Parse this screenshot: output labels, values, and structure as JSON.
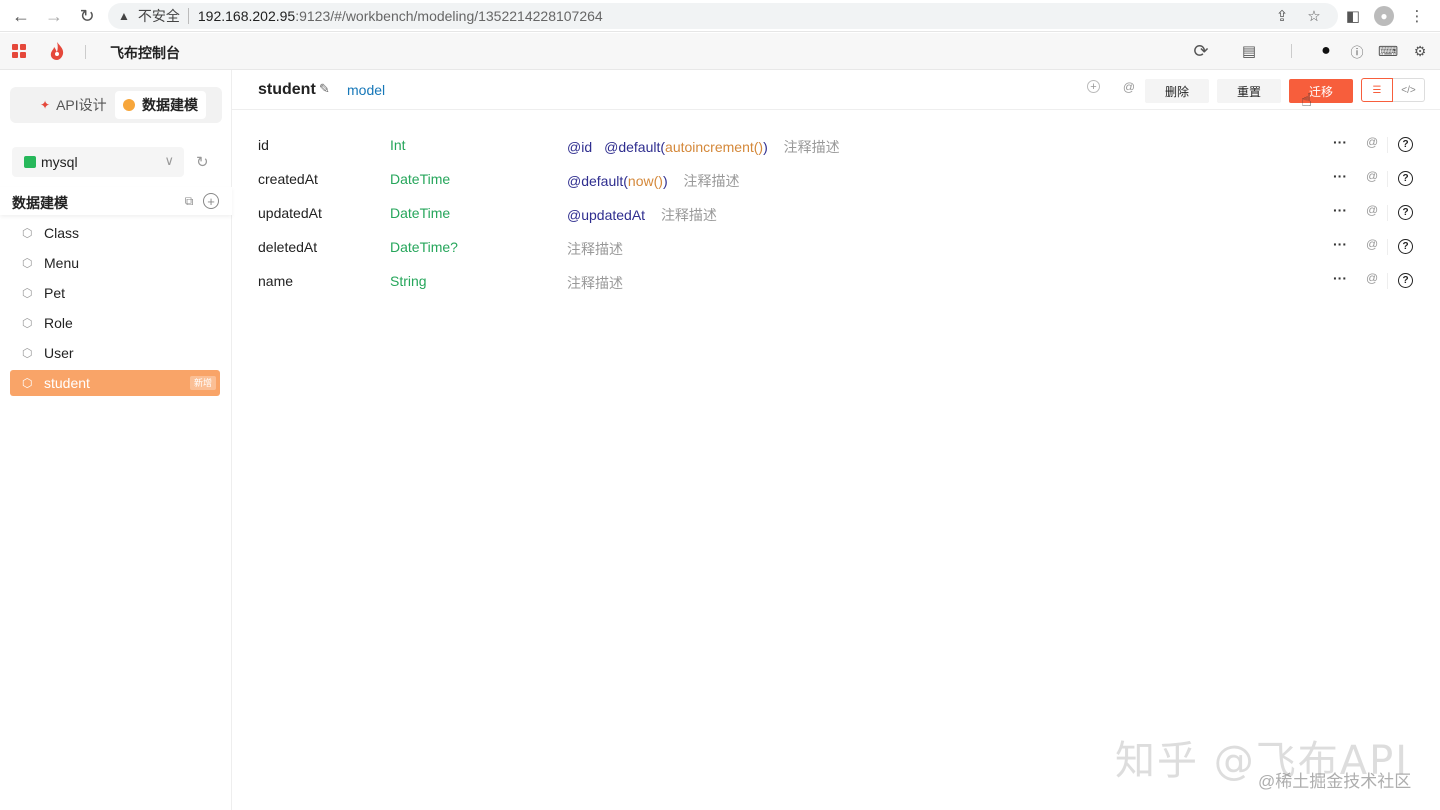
{
  "browser": {
    "back": "←",
    "forward": "→",
    "reload": "↻",
    "insecure_label": "不安全",
    "url_host": "192.168.202.95",
    "url_path": ":9123/#/workbench/modeling/1352214228107264"
  },
  "app": {
    "title": "飞布控制台",
    "brand_color": "#e5483b"
  },
  "sidebar": {
    "tabs": [
      {
        "label": "API设计"
      },
      {
        "label": "数据建模"
      }
    ],
    "datasource": "mysql",
    "section_title": "数据建模",
    "models": [
      {
        "label": "Class"
      },
      {
        "label": "Menu"
      },
      {
        "label": "Pet"
      },
      {
        "label": "Role"
      },
      {
        "label": "User"
      },
      {
        "label": "student",
        "badge": "新增"
      }
    ]
  },
  "main": {
    "model_name": "student",
    "model_kind": "model",
    "buttons": {
      "delete": "删除",
      "reset": "重置",
      "migrate": "迁移"
    },
    "fields": [
      {
        "name": "id",
        "type": "Int",
        "attrs": [
          "@id",
          "@default("
        ],
        "arg": "autoincrement()",
        "close": ")",
        "comment": "注释描述"
      },
      {
        "name": "createdAt",
        "type": "DateTime",
        "attrs": [
          "@default("
        ],
        "arg": "now()",
        "close": ")",
        "comment": "注释描述"
      },
      {
        "name": "updatedAt",
        "type": "DateTime",
        "attrs": [
          "@updatedAt"
        ],
        "arg": "",
        "close": "",
        "comment": "注释描述"
      },
      {
        "name": "deletedAt",
        "type": "DateTime?",
        "attrs": [],
        "arg": "",
        "close": "",
        "comment": "注释描述"
      },
      {
        "name": "name",
        "type": "String",
        "attrs": [],
        "arg": "",
        "close": "",
        "comment": "注释描述"
      }
    ]
  },
  "watermark": {
    "main": "知乎 @飞布API",
    "sub": "@稀土掘金技术社区"
  }
}
